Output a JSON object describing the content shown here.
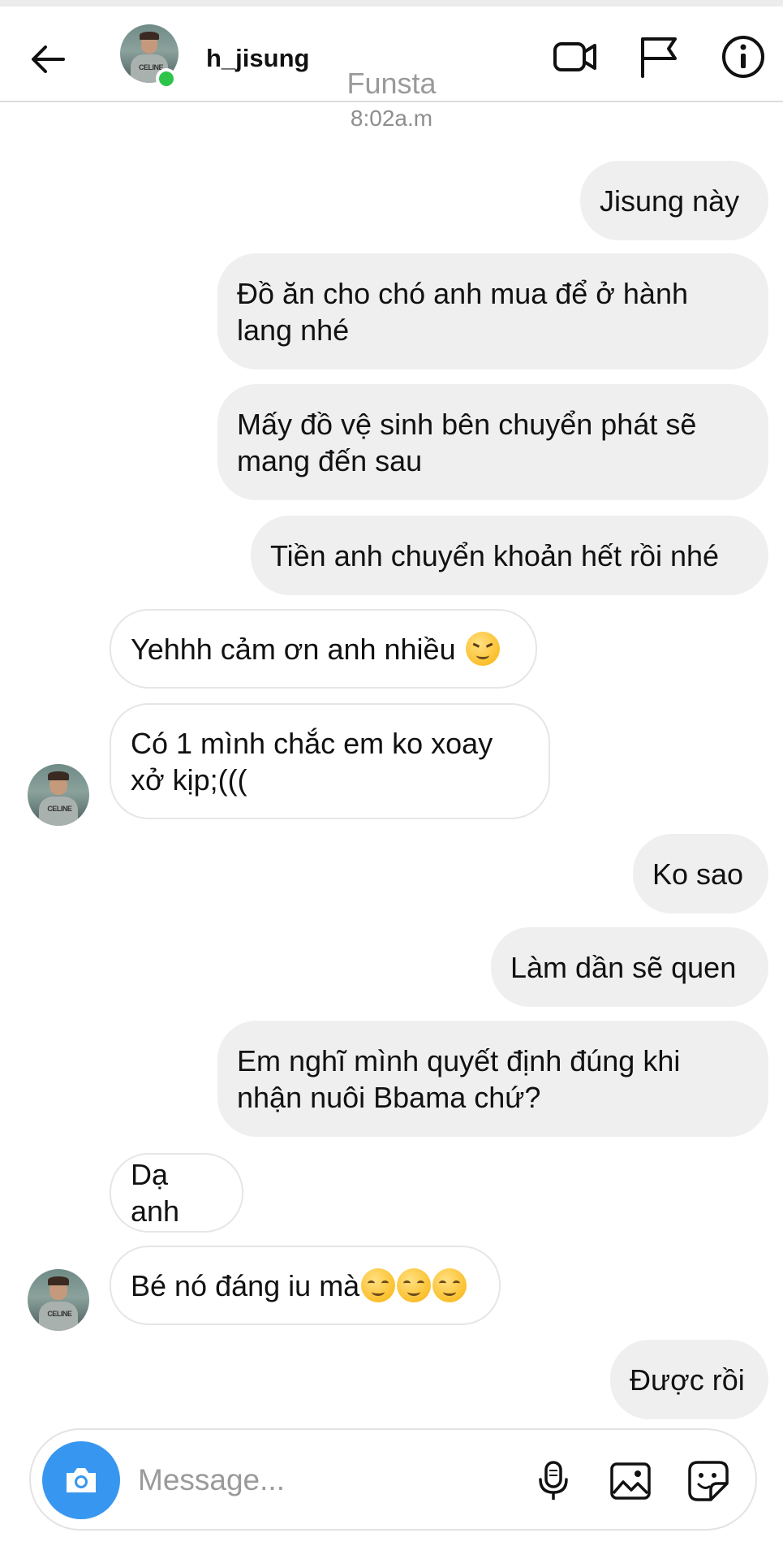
{
  "header": {
    "username": "h_jisung",
    "watermark": "Funsta",
    "avatar_shirt_text": "CELINE",
    "online_color": "#2ec44a"
  },
  "conversation": {
    "timestamp": "8:02a.m",
    "messages": [
      {
        "from": "me",
        "text": "Jisung này"
      },
      {
        "from": "me",
        "text": "Đồ ăn cho chó anh mua để ở hành lang nhé"
      },
      {
        "from": "me",
        "text": "Mấy đồ vệ sinh bên chuyển phát sẽ mang đến sau"
      },
      {
        "from": "me",
        "text": "Tiền anh chuyển khoản hết rồi nhé"
      },
      {
        "from": "them",
        "text": "Yehhh cảm ơn anh nhiều",
        "emoji": "squint-smile"
      },
      {
        "from": "them",
        "text": "Có 1 mình chắc em ko xoay xở kịp;(((",
        "avatar": true
      },
      {
        "from": "me",
        "text": "Ko sao"
      },
      {
        "from": "me",
        "text": "Làm dần sẽ quen"
      },
      {
        "from": "me",
        "text": "Em nghĩ mình quyết định đúng khi nhận nuôi Bbama chứ?"
      },
      {
        "from": "them",
        "text": "Dạ anh"
      },
      {
        "from": "them",
        "text": "Bé nó đáng iu mà",
        "emoji": "smile-x3",
        "avatar": true
      },
      {
        "from": "me",
        "text": "Được rồi"
      }
    ]
  },
  "composer": {
    "placeholder": "Message...",
    "camera_color": "#3797f0"
  },
  "icons": {
    "back": "back-arrow-icon",
    "video": "video-call-icon",
    "flag": "flag-icon",
    "info": "info-icon",
    "camera": "camera-icon",
    "mic": "microphone-icon",
    "gallery": "gallery-icon",
    "sticker": "sticker-icon"
  },
  "colors": {
    "sent_bubble": "#efefef",
    "received_border": "#e6e6e6"
  }
}
